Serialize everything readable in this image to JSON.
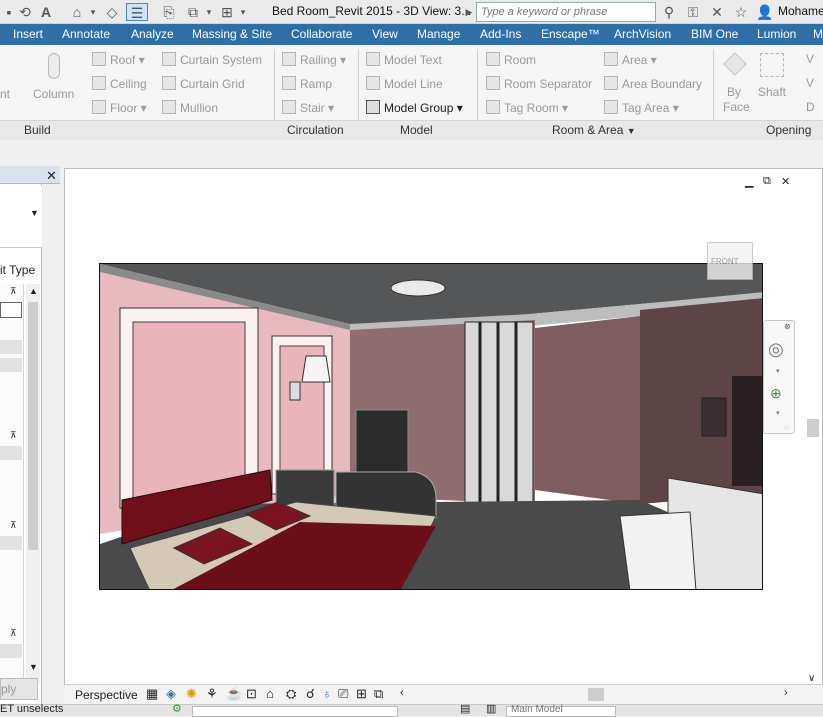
{
  "titlebar": {
    "title": "Bed Room_Revit 2015 - 3D View: 3...",
    "search_placeholder": "Type a keyword or phrase",
    "user_name": "Mohame"
  },
  "menu": {
    "tabs": [
      "Insert",
      "Annotate",
      "Analyze",
      "Massing & Site",
      "Collaborate",
      "View",
      "Manage",
      "Add-Ins",
      "Enscape™",
      "ArchVision",
      "BIM One",
      "Lumion",
      "M"
    ]
  },
  "ribbon": {
    "build": {
      "cut_label": "nt",
      "column": "Column",
      "roof": "Roof",
      "ceiling": "Ceiling",
      "floor": "Floor",
      "curtain_system": "Curtain System",
      "curtain_grid": "Curtain Grid",
      "mullion": "Mullion",
      "title": "Build"
    },
    "circulation": {
      "railing": "Railing",
      "ramp": "Ramp",
      "stair": "Stair",
      "title": "Circulation"
    },
    "model": {
      "model_text": "Model Text",
      "model_line": "Model Line",
      "model_group": "Model Group",
      "title": "Model"
    },
    "room_area": {
      "room": "Room",
      "room_separator": "Room Separator",
      "tag_room": "Tag Room",
      "area": "Area",
      "area_boundary": "Area Boundary",
      "tag_area": "Tag Area",
      "title": "Room & Area"
    },
    "opening": {
      "by_face_1": "By",
      "by_face_2": "Face",
      "shaft": "Shaft",
      "title": "Opening"
    }
  },
  "properties": {
    "type_label": "it Type",
    "apply_label": "ply"
  },
  "view": {
    "viewcube_label": "FRONT",
    "perspective_label": "Perspective"
  },
  "statusbar": {
    "left_text": "ET unselects",
    "model_label": "Main Model"
  },
  "colors": {
    "menu_bg": "#2f6fa8",
    "wall_pink": "#e7b7bd",
    "wall_mauve": "#8c6a6e",
    "bed_red": "#6e0f19"
  }
}
